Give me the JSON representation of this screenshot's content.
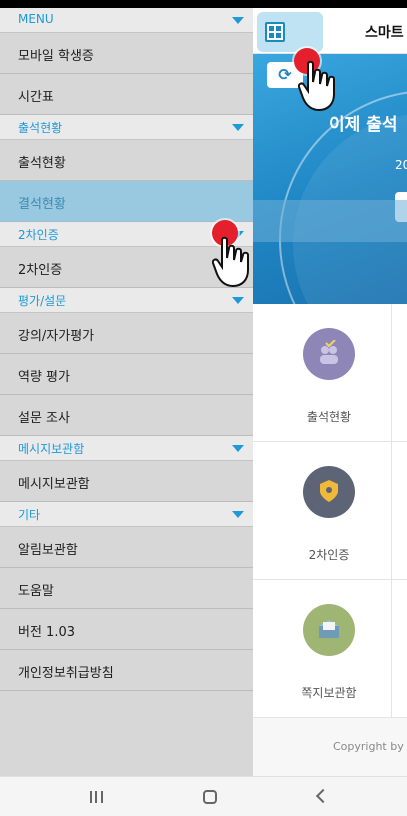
{
  "app": {
    "title": "스마트",
    "banner": {
      "headline": "이제 출석",
      "subline": "20"
    },
    "tiles": [
      {
        "label": "출석현황",
        "icon": "attendance-icon"
      },
      {
        "label": "2차인증",
        "icon": "shield-icon"
      },
      {
        "label": "쪽지보관함",
        "icon": "message-box-icon"
      }
    ],
    "footer": "Copyright by"
  },
  "drawer": {
    "sections": [
      {
        "title": "MENU",
        "items": [
          "모바일 학생증",
          "시간표"
        ]
      },
      {
        "title": "출석현황",
        "items": [
          "출석현황",
          "결석현황"
        ]
      },
      {
        "title": "2차인증",
        "items": [
          "2차인증"
        ]
      },
      {
        "title": "평가/설문",
        "items": [
          "강의/자가평가",
          "역량 평가",
          "설문 조사"
        ]
      },
      {
        "title": "메시지보관함",
        "items": [
          "메시지보관함"
        ]
      },
      {
        "title": "기타",
        "items": [
          "알림보관함",
          "도움말",
          "버전 1.03",
          "개인정보취급방침"
        ]
      }
    ],
    "active_item": "결석현황"
  },
  "navbar": {
    "recents": "recents-icon",
    "home": "home-icon",
    "back": "back-icon"
  },
  "colors": {
    "section_text": "#1d9ad8",
    "drawer_bg": "#d7d7d7",
    "banner": "#1f86c4",
    "touch": "#e3202c"
  }
}
